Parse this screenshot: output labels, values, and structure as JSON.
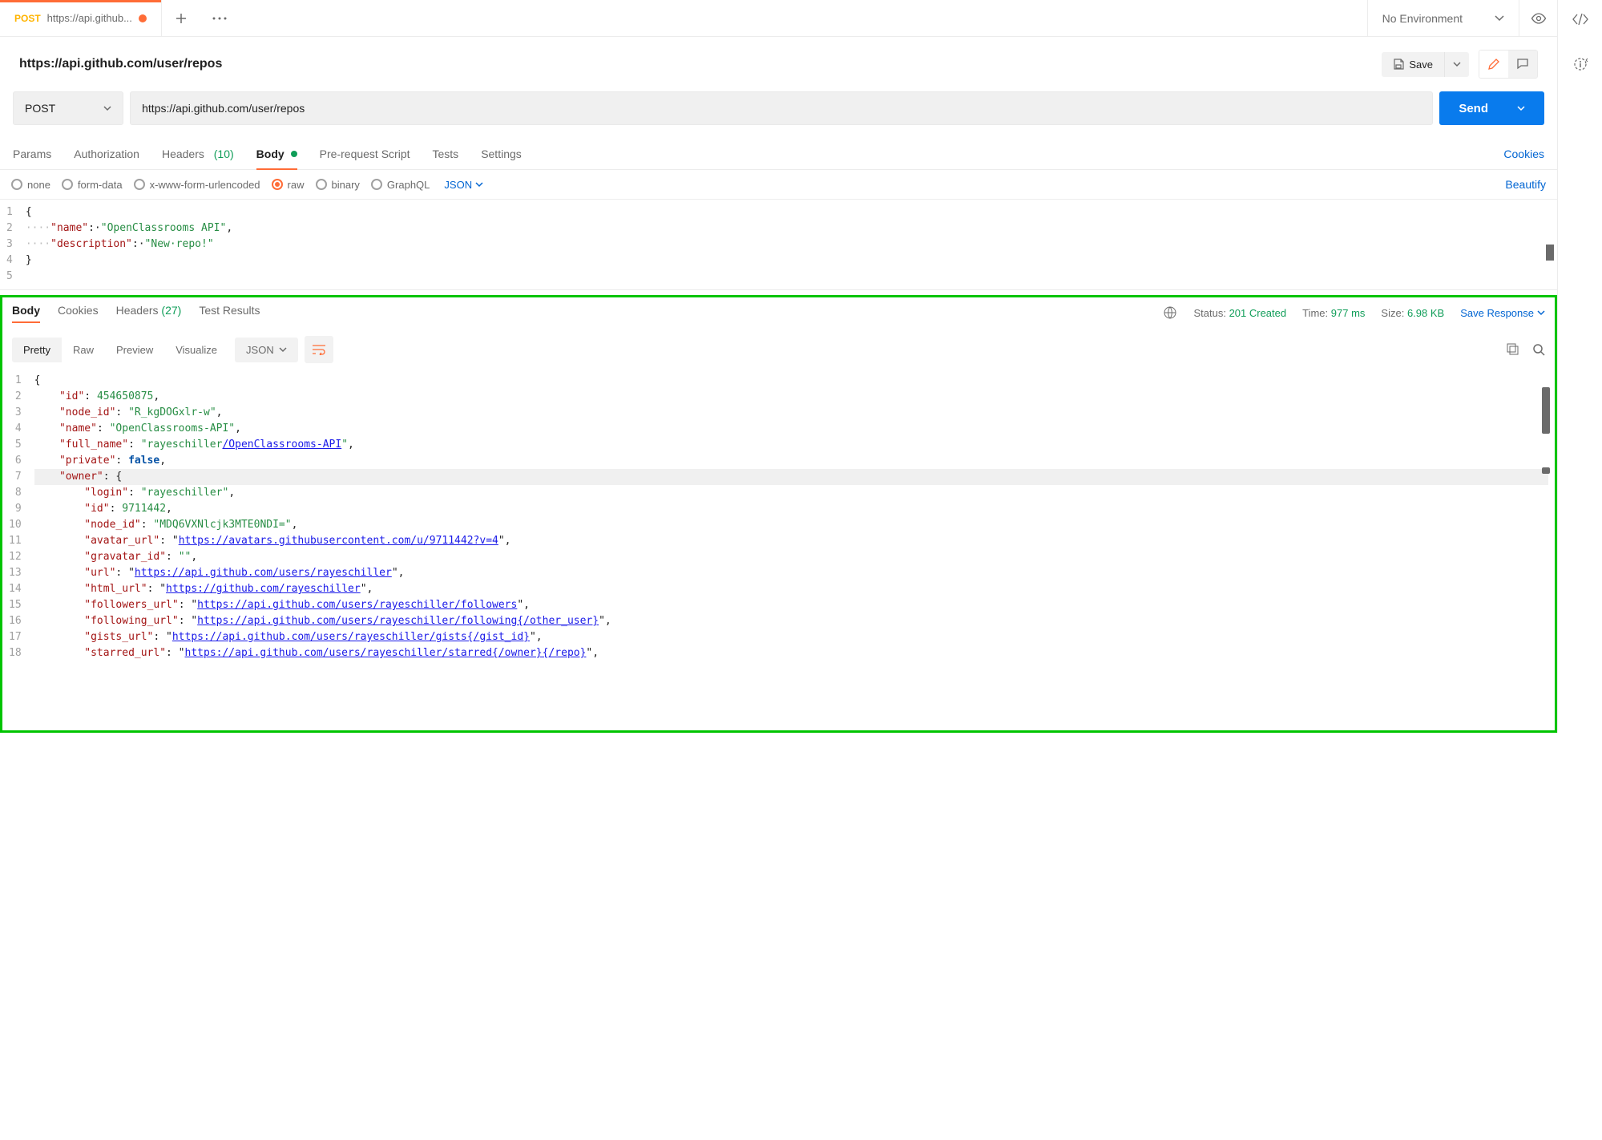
{
  "tab": {
    "method": "POST",
    "title": "https://api.github..."
  },
  "env": {
    "label": "No Environment"
  },
  "request": {
    "title": "https://api.github.com/user/repos",
    "method": "POST",
    "url": "https://api.github.com/user/repos",
    "send_label": "Send",
    "save_label": "Save"
  },
  "req_tabs": {
    "params": "Params",
    "authorization": "Authorization",
    "headers": "Headers",
    "headers_count": "(10)",
    "body": "Body",
    "pre_request": "Pre-request Script",
    "tests": "Tests",
    "settings": "Settings",
    "cookies": "Cookies"
  },
  "body_types": {
    "none": "none",
    "form_data": "form-data",
    "url_encoded": "x-www-form-urlencoded",
    "raw": "raw",
    "binary": "binary",
    "graphql": "GraphQL",
    "format": "JSON",
    "beautify": "Beautify"
  },
  "req_body": [
    {
      "n": "1",
      "t": [
        {
          "c": "",
          "v": "{"
        }
      ]
    },
    {
      "n": "2",
      "t": [
        {
          "c": "ws",
          "v": "····"
        },
        {
          "c": "key",
          "v": "\"name\""
        },
        {
          "c": "",
          "v": ":·"
        },
        {
          "c": "str",
          "v": "\"OpenClassrooms API\""
        },
        {
          "c": "",
          "v": ","
        }
      ]
    },
    {
      "n": "3",
      "t": [
        {
          "c": "ws",
          "v": "····"
        },
        {
          "c": "key",
          "v": "\"description\""
        },
        {
          "c": "",
          "v": ":·"
        },
        {
          "c": "str",
          "v": "\"New·repo!\""
        }
      ]
    },
    {
      "n": "4",
      "t": [
        {
          "c": "",
          "v": "}"
        }
      ]
    },
    {
      "n": "5",
      "t": [
        {
          "c": "",
          "v": ""
        }
      ]
    }
  ],
  "resp_tabs": {
    "body": "Body",
    "cookies": "Cookies",
    "headers": "Headers",
    "headers_count": "(27)",
    "test_results": "Test Results"
  },
  "resp_meta": {
    "status_label": "Status:",
    "status_val": "201 Created",
    "time_label": "Time:",
    "time_val": "977 ms",
    "size_label": "Size:",
    "size_val": "6.98 KB",
    "save_response": "Save Response"
  },
  "resp_format": {
    "pretty": "Pretty",
    "raw": "Raw",
    "preview": "Preview",
    "visualize": "Visualize",
    "format": "JSON"
  },
  "resp_body": [
    {
      "n": "1",
      "t": [
        {
          "c": "",
          "v": "{"
        }
      ]
    },
    {
      "n": "2",
      "t": [
        {
          "c": "",
          "v": "    "
        },
        {
          "c": "key",
          "v": "\"id\""
        },
        {
          "c": "",
          "v": ": "
        },
        {
          "c": "num",
          "v": "454650875"
        },
        {
          "c": "",
          "v": ","
        }
      ]
    },
    {
      "n": "3",
      "t": [
        {
          "c": "",
          "v": "    "
        },
        {
          "c": "key",
          "v": "\"node_id\""
        },
        {
          "c": "",
          "v": ": "
        },
        {
          "c": "str",
          "v": "\"R_kgDOGxlr-w\""
        },
        {
          "c": "",
          "v": ","
        }
      ]
    },
    {
      "n": "4",
      "t": [
        {
          "c": "",
          "v": "    "
        },
        {
          "c": "key",
          "v": "\"name\""
        },
        {
          "c": "",
          "v": ": "
        },
        {
          "c": "str",
          "v": "\"OpenClassrooms-API\""
        },
        {
          "c": "",
          "v": ","
        }
      ]
    },
    {
      "n": "5",
      "t": [
        {
          "c": "",
          "v": "    "
        },
        {
          "c": "key",
          "v": "\"full_name\""
        },
        {
          "c": "",
          "v": ": "
        },
        {
          "c": "str",
          "v": "\"rayeschiller"
        },
        {
          "c": "link",
          "v": "/OpenClassrooms-API"
        },
        {
          "c": "str",
          "v": "\""
        },
        {
          "c": "",
          "v": ","
        }
      ]
    },
    {
      "n": "6",
      "t": [
        {
          "c": "",
          "v": "    "
        },
        {
          "c": "key",
          "v": "\"private\""
        },
        {
          "c": "",
          "v": ": "
        },
        {
          "c": "bool",
          "v": "false"
        },
        {
          "c": "",
          "v": ","
        }
      ]
    },
    {
      "n": "7",
      "hl": true,
      "t": [
        {
          "c": "",
          "v": "    "
        },
        {
          "c": "key",
          "v": "\"owner\""
        },
        {
          "c": "",
          "v": ": {"
        }
      ]
    },
    {
      "n": "8",
      "t": [
        {
          "c": "",
          "v": "        "
        },
        {
          "c": "key",
          "v": "\"login\""
        },
        {
          "c": "",
          "v": ": "
        },
        {
          "c": "str",
          "v": "\"rayeschiller\""
        },
        {
          "c": "",
          "v": ","
        }
      ]
    },
    {
      "n": "9",
      "t": [
        {
          "c": "",
          "v": "        "
        },
        {
          "c": "key",
          "v": "\"id\""
        },
        {
          "c": "",
          "v": ": "
        },
        {
          "c": "num",
          "v": "9711442"
        },
        {
          "c": "",
          "v": ","
        }
      ]
    },
    {
      "n": "10",
      "t": [
        {
          "c": "",
          "v": "        "
        },
        {
          "c": "key",
          "v": "\"node_id\""
        },
        {
          "c": "",
          "v": ": "
        },
        {
          "c": "str",
          "v": "\"MDQ6VXNlcjk3MTE0NDI=\""
        },
        {
          "c": "",
          "v": ","
        }
      ]
    },
    {
      "n": "11",
      "t": [
        {
          "c": "",
          "v": "        "
        },
        {
          "c": "key",
          "v": "\"avatar_url\""
        },
        {
          "c": "",
          "v": ": \""
        },
        {
          "c": "link",
          "v": "https://avatars.githubusercontent.com/u/9711442?v=4"
        },
        {
          "c": "",
          "v": "\","
        }
      ]
    },
    {
      "n": "12",
      "t": [
        {
          "c": "",
          "v": "        "
        },
        {
          "c": "key",
          "v": "\"gravatar_id\""
        },
        {
          "c": "",
          "v": ": "
        },
        {
          "c": "str",
          "v": "\"\""
        },
        {
          "c": "",
          "v": ","
        }
      ]
    },
    {
      "n": "13",
      "t": [
        {
          "c": "",
          "v": "        "
        },
        {
          "c": "key",
          "v": "\"url\""
        },
        {
          "c": "",
          "v": ": \""
        },
        {
          "c": "link",
          "v": "https://api.github.com/users/rayeschiller"
        },
        {
          "c": "",
          "v": "\","
        }
      ]
    },
    {
      "n": "14",
      "t": [
        {
          "c": "",
          "v": "        "
        },
        {
          "c": "key",
          "v": "\"html_url\""
        },
        {
          "c": "",
          "v": ": \""
        },
        {
          "c": "link",
          "v": "https://github.com/rayeschiller"
        },
        {
          "c": "",
          "v": "\","
        }
      ]
    },
    {
      "n": "15",
      "t": [
        {
          "c": "",
          "v": "        "
        },
        {
          "c": "key",
          "v": "\"followers_url\""
        },
        {
          "c": "",
          "v": ": \""
        },
        {
          "c": "link",
          "v": "https://api.github.com/users/rayeschiller/followers"
        },
        {
          "c": "",
          "v": "\","
        }
      ]
    },
    {
      "n": "16",
      "t": [
        {
          "c": "",
          "v": "        "
        },
        {
          "c": "key",
          "v": "\"following_url\""
        },
        {
          "c": "",
          "v": ": \""
        },
        {
          "c": "link",
          "v": "https://api.github.com/users/rayeschiller/following{/other_user}"
        },
        {
          "c": "",
          "v": "\","
        }
      ]
    },
    {
      "n": "17",
      "t": [
        {
          "c": "",
          "v": "        "
        },
        {
          "c": "key",
          "v": "\"gists_url\""
        },
        {
          "c": "",
          "v": ": \""
        },
        {
          "c": "link",
          "v": "https://api.github.com/users/rayeschiller/gists{/gist_id}"
        },
        {
          "c": "",
          "v": "\","
        }
      ]
    },
    {
      "n": "18",
      "t": [
        {
          "c": "",
          "v": "        "
        },
        {
          "c": "key",
          "v": "\"starred_url\""
        },
        {
          "c": "",
          "v": ": \""
        },
        {
          "c": "link",
          "v": "https://api.github.com/users/rayeschiller/starred{/owner}{/repo}"
        },
        {
          "c": "",
          "v": "\","
        }
      ]
    }
  ]
}
